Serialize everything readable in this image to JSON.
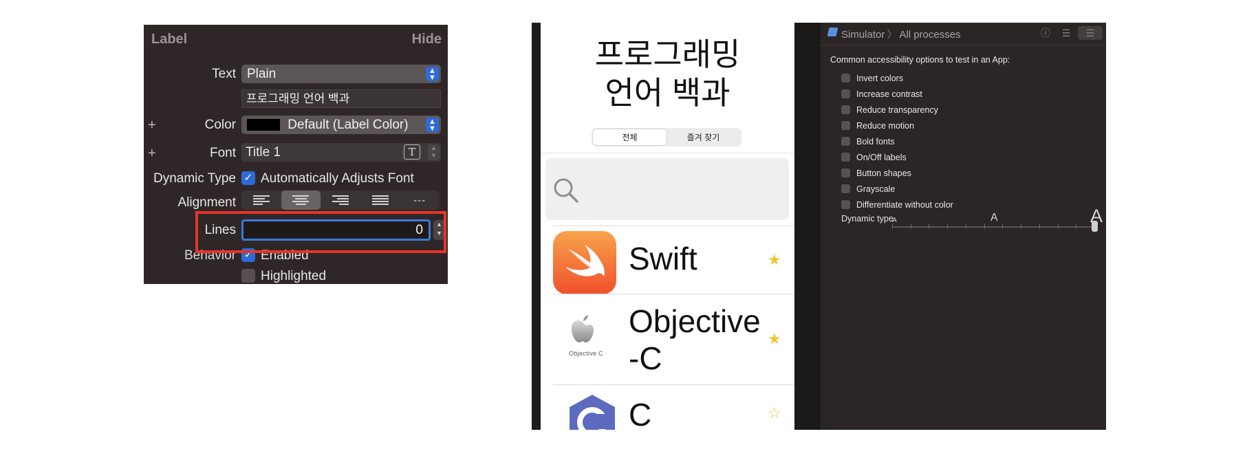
{
  "inspector": {
    "section_title": "Label",
    "hide_label": "Hide",
    "text_label": "Text",
    "text_type": "Plain",
    "text_value": "프로그래밍 언어 백과",
    "color_label": "Color",
    "color_value": "Default (Label Color)",
    "font_label": "Font",
    "font_value": "Title 1",
    "font_button_glyph": "T",
    "dynamic_type_label": "Dynamic Type",
    "dynamic_type_option": "Automatically Adjusts Font",
    "alignment_label": "Alignment",
    "alignment_selected": "center",
    "alignment_natural_glyph": "---",
    "lines_label": "Lines",
    "lines_value": "0",
    "behavior_label": "Behavior",
    "behavior_enabled": "Enabled",
    "behavior_highlighted": "Highlighted",
    "plus_glyph": "+",
    "colors": {
      "panel": "#2f2727",
      "accent": "#2e6bd6",
      "highlight_box": "#e8342a"
    }
  },
  "simulator": {
    "title_line1": "프로그래밍",
    "title_line2": "언어 백과",
    "segments": [
      "전체",
      "즐겨 찾기"
    ],
    "selected_segment": 0,
    "languages": [
      {
        "name": "Swift",
        "icon": "swift-logo-icon",
        "favorite": true
      },
      {
        "name_line1": "Objective",
        "name_line2": "-C",
        "icon": "apple-logo-icon",
        "icon_caption": "Objective C",
        "favorite": true
      },
      {
        "name": "C",
        "icon": "c-logo-icon",
        "favorite": false
      }
    ],
    "star_filled": "★",
    "star_empty": "☆",
    "colors": {
      "star": "#f3c532"
    }
  },
  "accessibility": {
    "target_app": "Simulator",
    "target_scope": "All processes",
    "toolbar_icons": [
      "info-icon",
      "list-icon",
      "settings-icon"
    ],
    "heading": "Common accessibility options to test in an App:",
    "options": [
      "Invert colors",
      "Increase contrast",
      "Reduce transparency",
      "Reduce motion",
      "Bold fonts",
      "On/Off labels",
      "Button shapes",
      "Grayscale",
      "Differentiate without color"
    ],
    "dynamic_type_label": "Dynamic type",
    "dynamic_type_level": 1.0,
    "size_markers": [
      "A",
      "A",
      "A"
    ]
  }
}
